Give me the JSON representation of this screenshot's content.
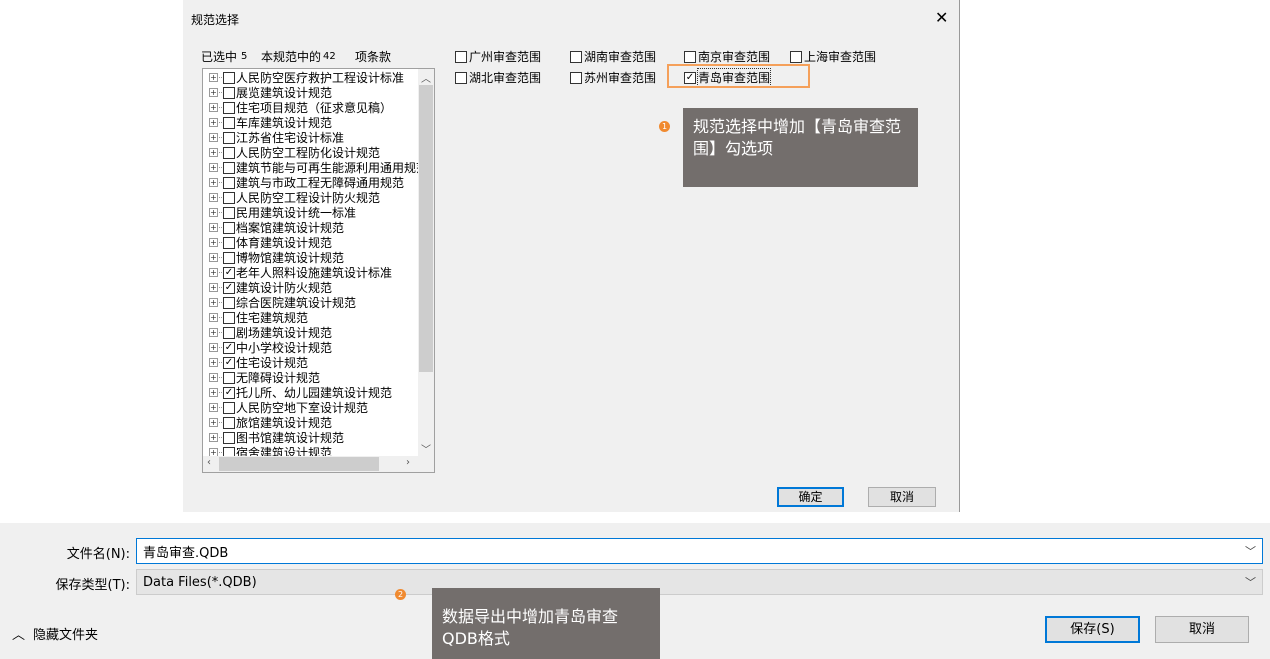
{
  "dialog": {
    "title": "规范选择",
    "close": "✕",
    "stats": {
      "selected_label": "已选中",
      "selected": "5",
      "total_label": "本规范中的",
      "total": "42",
      "items_label": "项条款"
    },
    "tree": [
      {
        "label": "人民防空医疗救护工程设计标准",
        "checked": false
      },
      {
        "label": "展览建筑设计规范",
        "checked": false
      },
      {
        "label": "住宅项目规范（征求意见稿）",
        "checked": false
      },
      {
        "label": "车库建筑设计规范",
        "checked": false
      },
      {
        "label": "江苏省住宅设计标准",
        "checked": false
      },
      {
        "label": "人民防空工程防化设计规范",
        "checked": false
      },
      {
        "label": "建筑节能与可再生能源利用通用规范",
        "checked": false
      },
      {
        "label": "建筑与市政工程无障碍通用规范",
        "checked": false
      },
      {
        "label": "人民防空工程设计防火规范",
        "checked": false
      },
      {
        "label": "民用建筑设计统一标准",
        "checked": false
      },
      {
        "label": "档案馆建筑设计规范",
        "checked": false
      },
      {
        "label": "体育建筑设计规范",
        "checked": false
      },
      {
        "label": "博物馆建筑设计规范",
        "checked": false
      },
      {
        "label": "老年人照料设施建筑设计标准",
        "checked": true
      },
      {
        "label": "建筑设计防火规范",
        "checked": true
      },
      {
        "label": "综合医院建筑设计规范",
        "checked": false
      },
      {
        "label": "住宅建筑规范",
        "checked": false
      },
      {
        "label": "剧场建筑设计规范",
        "checked": false
      },
      {
        "label": "中小学校设计规范",
        "checked": true
      },
      {
        "label": "住宅设计规范",
        "checked": true
      },
      {
        "label": "无障碍设计规范",
        "checked": false
      },
      {
        "label": "托儿所、幼儿园建筑设计规范",
        "checked": true
      },
      {
        "label": "人民防空地下室设计规范",
        "checked": false
      },
      {
        "label": "旅馆建筑设计规范",
        "checked": false
      },
      {
        "label": "图书馆建筑设计规范",
        "checked": false
      },
      {
        "label": "宿舍建筑设计规范",
        "checked": false
      }
    ],
    "scopes": [
      {
        "label": "广州审查范围",
        "checked": false
      },
      {
        "label": "湖南审查范围",
        "checked": false
      },
      {
        "label": "南京审查范围",
        "checked": false
      },
      {
        "label": "上海审查范围",
        "checked": false
      },
      {
        "label": "湖北审查范围",
        "checked": false
      },
      {
        "label": "苏州审查范围",
        "checked": false
      },
      {
        "label": "青岛审查范围",
        "checked": true
      }
    ],
    "ok": "确定",
    "cancel": "取消"
  },
  "callouts": [
    {
      "num": "1",
      "text": "规范选择中增加【青岛审查范围】勾选项"
    },
    {
      "num": "2",
      "text": "数据导出中增加青岛审查QDB格式"
    }
  ],
  "save": {
    "filename_label": "文件名(N):",
    "filename": "青岛审查.QDB",
    "type_label": "保存类型(T):",
    "type": "Data Files(*.QDB)",
    "hide_folders": "隐藏文件夹",
    "save": "保存(S)",
    "cancel": "取消"
  },
  "colors": {
    "accent": "#0078d7",
    "highlight": "#f5a05a",
    "callout_bg": "#736e6c",
    "dot": "#f08a30"
  }
}
